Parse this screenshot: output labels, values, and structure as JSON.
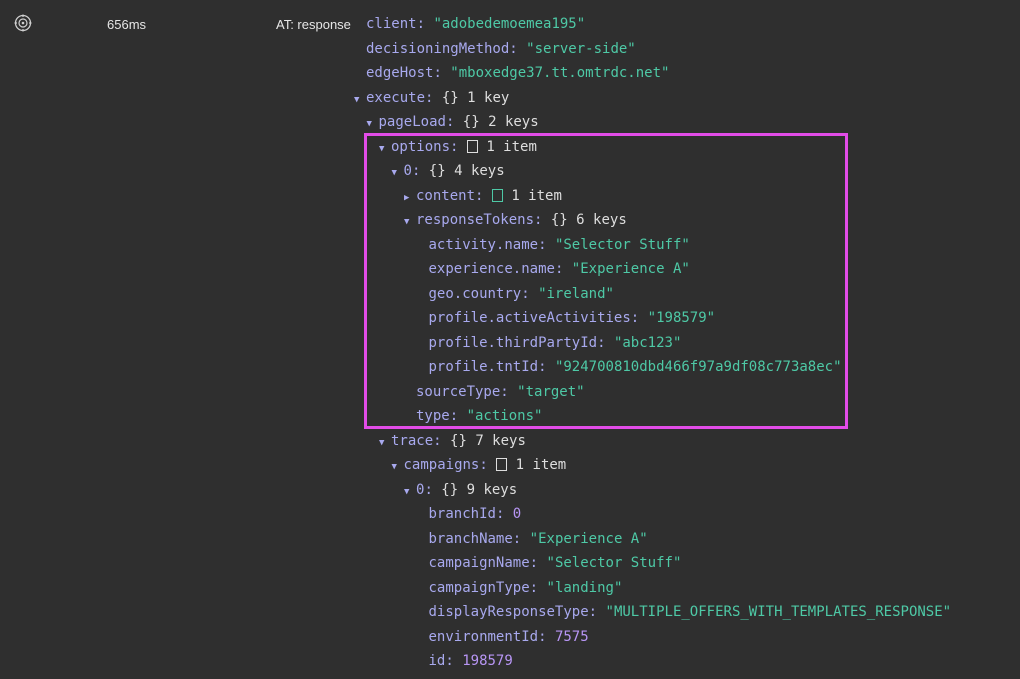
{
  "request": {
    "timing": "656ms",
    "source": "AT: response",
    "icon": "target-icon"
  },
  "tree": [
    {
      "depth": 0,
      "toggle": "",
      "key": "client",
      "kind": "string",
      "value": "\"adobedemoemea195\""
    },
    {
      "depth": 0,
      "toggle": "",
      "key": "decisioningMethod",
      "kind": "string",
      "value": "\"server-side\""
    },
    {
      "depth": 0,
      "toggle": "",
      "key": "edgeHost",
      "kind": "string",
      "value": "\"mboxedge37.tt.omtrdc.net\""
    },
    {
      "depth": 0,
      "toggle": "▼",
      "key": "execute",
      "kind": "object",
      "value": "1 key"
    },
    {
      "depth": 1,
      "toggle": "▼",
      "key": "pageLoad",
      "kind": "object",
      "value": "2 keys"
    },
    {
      "depth": 2,
      "toggle": "▼",
      "key": "options",
      "kind": "array",
      "value": "1 item"
    },
    {
      "depth": 3,
      "toggle": "▼",
      "key": "0",
      "kind": "object",
      "value": "4 keys"
    },
    {
      "depth": 4,
      "toggle": "▶",
      "key": "content",
      "kind": "array-green",
      "value": "1 item"
    },
    {
      "depth": 4,
      "toggle": "▼",
      "key": "responseTokens",
      "kind": "object",
      "value": "6 keys"
    },
    {
      "depth": 5,
      "toggle": "",
      "key": "activity.name",
      "kind": "string",
      "value": "\"Selector Stuff\""
    },
    {
      "depth": 5,
      "toggle": "",
      "key": "experience.name",
      "kind": "string",
      "value": "\"Experience A\""
    },
    {
      "depth": 5,
      "toggle": "",
      "key": "geo.country",
      "kind": "string",
      "value": "\"ireland\""
    },
    {
      "depth": 5,
      "toggle": "",
      "key": "profile.activeActivities",
      "kind": "string",
      "value": "\"198579\""
    },
    {
      "depth": 5,
      "toggle": "",
      "key": "profile.thirdPartyId",
      "kind": "string",
      "value": "\"abc123\""
    },
    {
      "depth": 5,
      "toggle": "",
      "key": "profile.tntId",
      "kind": "string",
      "value": "\"924700810dbd466f97a9df08c773a8ec\""
    },
    {
      "depth": 4,
      "toggle": "",
      "key": "sourceType",
      "kind": "string",
      "value": "\"target\""
    },
    {
      "depth": 4,
      "toggle": "",
      "key": "type",
      "kind": "string",
      "value": "\"actions\""
    },
    {
      "depth": 2,
      "toggle": "▼",
      "key": "trace",
      "kind": "object",
      "value": "7 keys"
    },
    {
      "depth": 3,
      "toggle": "▼",
      "key": "campaigns",
      "kind": "array",
      "value": "1 item"
    },
    {
      "depth": 4,
      "toggle": "▼",
      "key": "0",
      "kind": "object",
      "value": "9 keys"
    },
    {
      "depth": 5,
      "toggle": "",
      "key": "branchId",
      "kind": "number",
      "value": "0"
    },
    {
      "depth": 5,
      "toggle": "",
      "key": "branchName",
      "kind": "string",
      "value": "\"Experience A\""
    },
    {
      "depth": 5,
      "toggle": "",
      "key": "campaignName",
      "kind": "string",
      "value": "\"Selector Stuff\""
    },
    {
      "depth": 5,
      "toggle": "",
      "key": "campaignType",
      "kind": "string",
      "value": "\"landing\""
    },
    {
      "depth": 5,
      "toggle": "",
      "key": "displayResponseType",
      "kind": "string",
      "value": "\"MULTIPLE_OFFERS_WITH_TEMPLATES_RESPONSE\""
    },
    {
      "depth": 5,
      "toggle": "",
      "key": "environmentId",
      "kind": "number",
      "value": "7575"
    },
    {
      "depth": 5,
      "toggle": "",
      "key": "id",
      "kind": "number",
      "value": "198579"
    }
  ],
  "colors": {
    "background": "#2f2f2f",
    "key": "#a8a9ee",
    "string": "#4ec9a6",
    "number": "#b896f5",
    "highlight": "#e24ce8"
  }
}
